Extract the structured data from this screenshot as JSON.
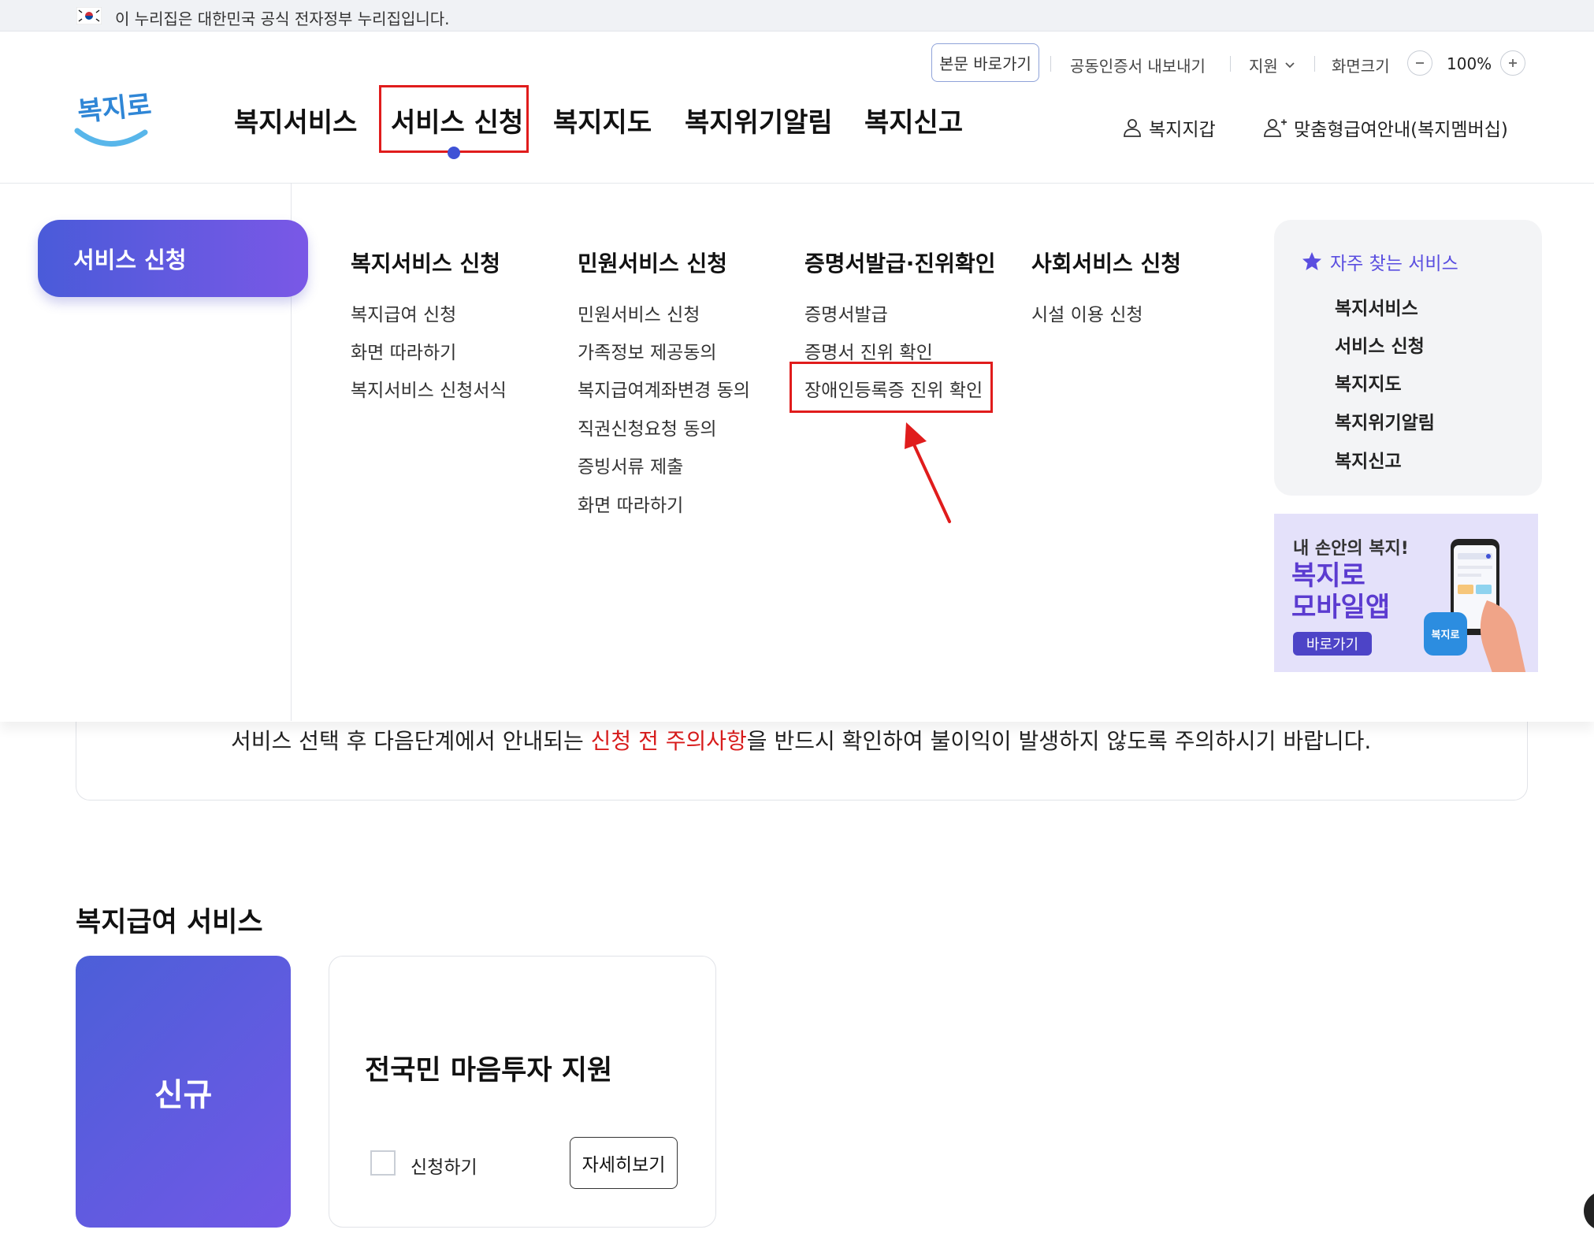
{
  "gov_banner": {
    "text": "이 누리집은 대한민국 공식 전자정부 누리집입니다."
  },
  "utility": {
    "skip": "본문 바로가기",
    "cert": "공동인증서 내보내기",
    "support": "지원",
    "screen_size": "화면크기",
    "zoom": "100%"
  },
  "logo": {
    "text": "복지로"
  },
  "gnb": [
    "복지서비스",
    "서비스 신청",
    "복지지도",
    "복지위기알림",
    "복지신고"
  ],
  "header_right": {
    "wallet": "복지지갑",
    "membership": "맞춤형급여안내(복지멤버십)"
  },
  "mega": {
    "side_title": "서비스 신청",
    "columns": [
      {
        "title": "복지서비스 신청",
        "items": [
          "복지급여 신청",
          "화면 따라하기",
          "복지서비스 신청서식"
        ]
      },
      {
        "title": "민원서비스 신청",
        "items": [
          "민원서비스 신청",
          "가족정보 제공동의",
          "복지급여계좌변경 동의",
          "직권신청요청 동의",
          "증빙서류 제출",
          "화면 따라하기"
        ]
      },
      {
        "title": "증명서발급·진위확인",
        "items": [
          "증명서발급",
          "증명서 진위 확인",
          "장애인등록증 진위 확인"
        ]
      },
      {
        "title": "사회서비스 신청",
        "items": [
          "시설 이용 신청"
        ]
      }
    ],
    "favorites": {
      "title": "자주 찾는 서비스",
      "items": [
        "복지서비스",
        "서비스 신청",
        "복지지도",
        "복지위기알림",
        "복지신고"
      ]
    },
    "app_banner": {
      "line1": "내 손안의 복지!",
      "line2": "복지로",
      "line3": "모바일앱",
      "button": "바로가기",
      "badge": "복지로"
    }
  },
  "notice": {
    "before": "서비스 선택 후 다음단계에서 안내되는 ",
    "highlight": "신청 전 주의사항",
    "after": "을 반드시 확인하여 불이익이 발생하지 않도록 주의하시기 바랍니다."
  },
  "section": {
    "title": "복지급여 서비스",
    "new_label": "신규",
    "card": {
      "title": "전국민 마음투자 지원",
      "apply": "신청하기",
      "detail": "자세히보기"
    }
  },
  "colors": {
    "accent": "#4a5bd9",
    "highlight_red": "#e01c1c",
    "notice_red": "#d81c1c",
    "favorite": "#5a4ee0"
  }
}
